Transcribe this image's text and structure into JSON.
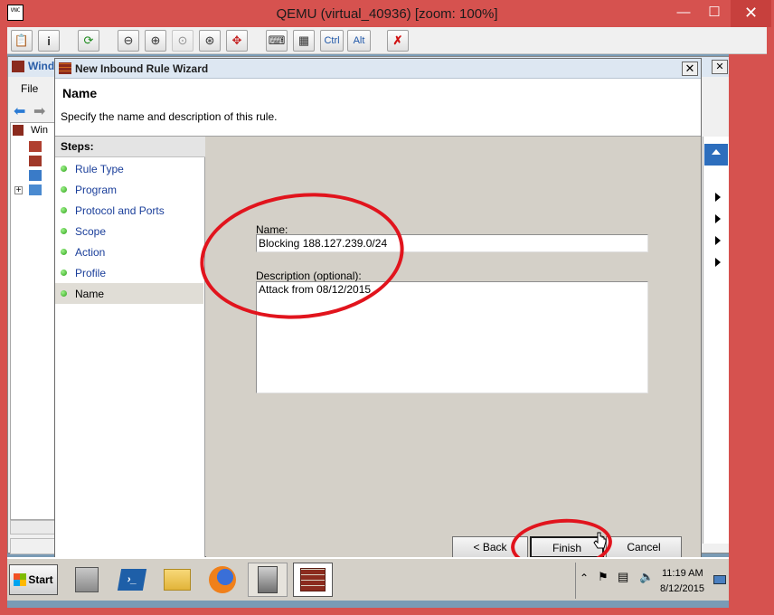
{
  "qemu": {
    "title": "QEMU (virtual_40936) [zoom: 100%]",
    "logo_text": "VNC",
    "window_controls": [
      "minimize",
      "maximize",
      "close"
    ],
    "toolbar": {
      "buttons": [
        {
          "icon": "clipboard-icon"
        },
        {
          "icon": "info-icon"
        },
        {
          "icon": "refresh-icon"
        },
        {
          "icon": "zoom-out-icon"
        },
        {
          "icon": "zoom-in-icon"
        },
        {
          "icon": "zoom-reset-icon"
        },
        {
          "icon": "zoom-auto-icon"
        },
        {
          "icon": "fullscreen-icon"
        },
        {
          "icon": "send-keys-icon"
        },
        {
          "icon": "ctrl-alt-del-icon"
        }
      ],
      "ctrl_label": "Ctrl",
      "alt_label": "Alt"
    }
  },
  "mmc": {
    "title": "Wind",
    "menu_file": "File",
    "tree_item": "Win"
  },
  "wizard": {
    "title": "New Inbound Rule Wizard",
    "heading": "Name",
    "subheading": "Specify the name and description of this rule.",
    "steps_title": "Steps:",
    "steps": [
      {
        "label": "Rule Type"
      },
      {
        "label": "Program"
      },
      {
        "label": "Protocol and Ports"
      },
      {
        "label": "Scope"
      },
      {
        "label": "Action"
      },
      {
        "label": "Profile"
      },
      {
        "label": "Name"
      }
    ],
    "active_step": "Name",
    "name_label": "Name:",
    "name_value": "Blocking 188.127.239.0/24",
    "description_label": "Description (optional):",
    "description_value": "Attack from 08/12/2015",
    "back_label": "< Back",
    "finish_label": "Finish",
    "cancel_label": "Cancel"
  },
  "taskbar": {
    "start_label": "Start",
    "apps": [
      "server-manager-icon",
      "powershell-icon",
      "file-explorer-icon",
      "firefox-icon",
      "admin-tools-icon",
      "firewall-icon"
    ],
    "clock_time": "11:19 AM",
    "clock_date": "8/12/2015"
  },
  "colors": {
    "qemu_frame": "#d6524f",
    "annotation_red": "#e1141d",
    "link_blue": "#1a3e9a",
    "step_bullet": "#2ea21a"
  }
}
